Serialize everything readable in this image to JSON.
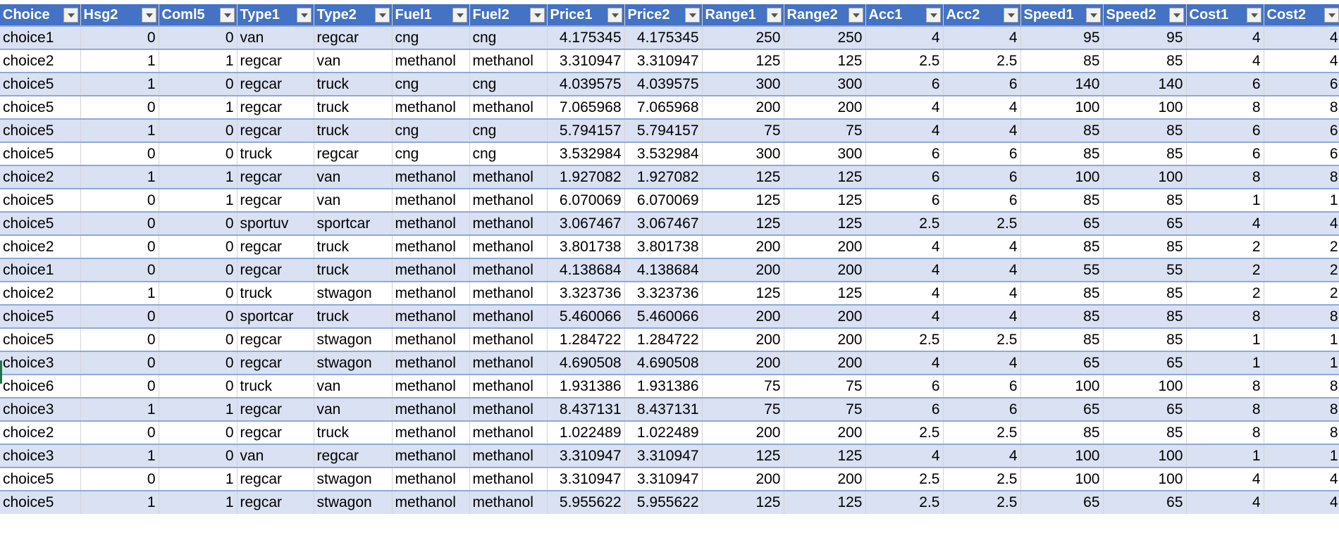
{
  "colors": {
    "header": "#4472C4",
    "band": "#D9E1F2",
    "border": "#8EA9DB"
  },
  "columns": [
    "Choice",
    "Hsg2",
    "Coml5",
    "Type1",
    "Type2",
    "Fuel1",
    "Fuel2",
    "Price1",
    "Price2",
    "Range1",
    "Range2",
    "Acc1",
    "Acc2",
    "Speed1",
    "Speed2",
    "Cost1",
    "Cost2"
  ],
  "rows": [
    [
      "choice1",
      "0",
      "0",
      "van",
      "regcar",
      "cng",
      "cng",
      "4.175345",
      "4.175345",
      "250",
      "250",
      "4",
      "4",
      "95",
      "95",
      "4",
      "4"
    ],
    [
      "choice2",
      "1",
      "1",
      "regcar",
      "van",
      "methanol",
      "methanol",
      "3.310947",
      "3.310947",
      "125",
      "125",
      "2.5",
      "2.5",
      "85",
      "85",
      "4",
      "4"
    ],
    [
      "choice5",
      "1",
      "0",
      "regcar",
      "truck",
      "cng",
      "cng",
      "4.039575",
      "4.039575",
      "300",
      "300",
      "6",
      "6",
      "140",
      "140",
      "6",
      "6"
    ],
    [
      "choice5",
      "0",
      "1",
      "regcar",
      "truck",
      "methanol",
      "methanol",
      "7.065968",
      "7.065968",
      "200",
      "200",
      "4",
      "4",
      "100",
      "100",
      "8",
      "8"
    ],
    [
      "choice5",
      "1",
      "0",
      "regcar",
      "truck",
      "cng",
      "cng",
      "5.794157",
      "5.794157",
      "75",
      "75",
      "4",
      "4",
      "85",
      "85",
      "6",
      "6"
    ],
    [
      "choice5",
      "0",
      "0",
      "truck",
      "regcar",
      "cng",
      "cng",
      "3.532984",
      "3.532984",
      "300",
      "300",
      "6",
      "6",
      "85",
      "85",
      "6",
      "6"
    ],
    [
      "choice2",
      "1",
      "1",
      "regcar",
      "van",
      "methanol",
      "methanol",
      "1.927082",
      "1.927082",
      "125",
      "125",
      "6",
      "6",
      "100",
      "100",
      "8",
      "8"
    ],
    [
      "choice5",
      "0",
      "1",
      "regcar",
      "van",
      "methanol",
      "methanol",
      "6.070069",
      "6.070069",
      "125",
      "125",
      "6",
      "6",
      "85",
      "85",
      "1",
      "1"
    ],
    [
      "choice5",
      "0",
      "0",
      "sportuv",
      "sportcar",
      "methanol",
      "methanol",
      "3.067467",
      "3.067467",
      "125",
      "125",
      "2.5",
      "2.5",
      "65",
      "65",
      "4",
      "4"
    ],
    [
      "choice2",
      "0",
      "0",
      "regcar",
      "truck",
      "methanol",
      "methanol",
      "3.801738",
      "3.801738",
      "200",
      "200",
      "4",
      "4",
      "85",
      "85",
      "2",
      "2"
    ],
    [
      "choice1",
      "0",
      "0",
      "regcar",
      "truck",
      "methanol",
      "methanol",
      "4.138684",
      "4.138684",
      "200",
      "200",
      "4",
      "4",
      "55",
      "55",
      "2",
      "2"
    ],
    [
      "choice2",
      "1",
      "0",
      "truck",
      "stwagon",
      "methanol",
      "methanol",
      "3.323736",
      "3.323736",
      "125",
      "125",
      "4",
      "4",
      "85",
      "85",
      "2",
      "2"
    ],
    [
      "choice5",
      "0",
      "0",
      "sportcar",
      "truck",
      "methanol",
      "methanol",
      "5.460066",
      "5.460066",
      "200",
      "200",
      "4",
      "4",
      "85",
      "85",
      "8",
      "8"
    ],
    [
      "choice5",
      "0",
      "0",
      "regcar",
      "stwagon",
      "methanol",
      "methanol",
      "1.284722",
      "1.284722",
      "200",
      "200",
      "2.5",
      "2.5",
      "85",
      "85",
      "1",
      "1"
    ],
    [
      "choice3",
      "0",
      "0",
      "regcar",
      "stwagon",
      "methanol",
      "methanol",
      "4.690508",
      "4.690508",
      "200",
      "200",
      "4",
      "4",
      "65",
      "65",
      "1",
      "1"
    ],
    [
      "choice6",
      "0",
      "0",
      "truck",
      "van",
      "methanol",
      "methanol",
      "1.931386",
      "1.931386",
      "75",
      "75",
      "6",
      "6",
      "100",
      "100",
      "8",
      "8"
    ],
    [
      "choice3",
      "1",
      "1",
      "regcar",
      "van",
      "methanol",
      "methanol",
      "8.437131",
      "8.437131",
      "75",
      "75",
      "6",
      "6",
      "65",
      "65",
      "8",
      "8"
    ],
    [
      "choice2",
      "0",
      "0",
      "regcar",
      "truck",
      "methanol",
      "methanol",
      "1.022489",
      "1.022489",
      "200",
      "200",
      "2.5",
      "2.5",
      "85",
      "85",
      "8",
      "8"
    ],
    [
      "choice3",
      "1",
      "0",
      "van",
      "regcar",
      "methanol",
      "methanol",
      "3.310947",
      "3.310947",
      "125",
      "125",
      "4",
      "4",
      "100",
      "100",
      "1",
      "1"
    ],
    [
      "choice5",
      "0",
      "1",
      "regcar",
      "stwagon",
      "methanol",
      "methanol",
      "3.310947",
      "3.310947",
      "200",
      "200",
      "2.5",
      "2.5",
      "100",
      "100",
      "4",
      "4"
    ],
    [
      "choice5",
      "1",
      "1",
      "regcar",
      "stwagon",
      "methanol",
      "methanol",
      "5.955622",
      "5.955622",
      "125",
      "125",
      "2.5",
      "2.5",
      "65",
      "65",
      "4",
      "4"
    ]
  ]
}
